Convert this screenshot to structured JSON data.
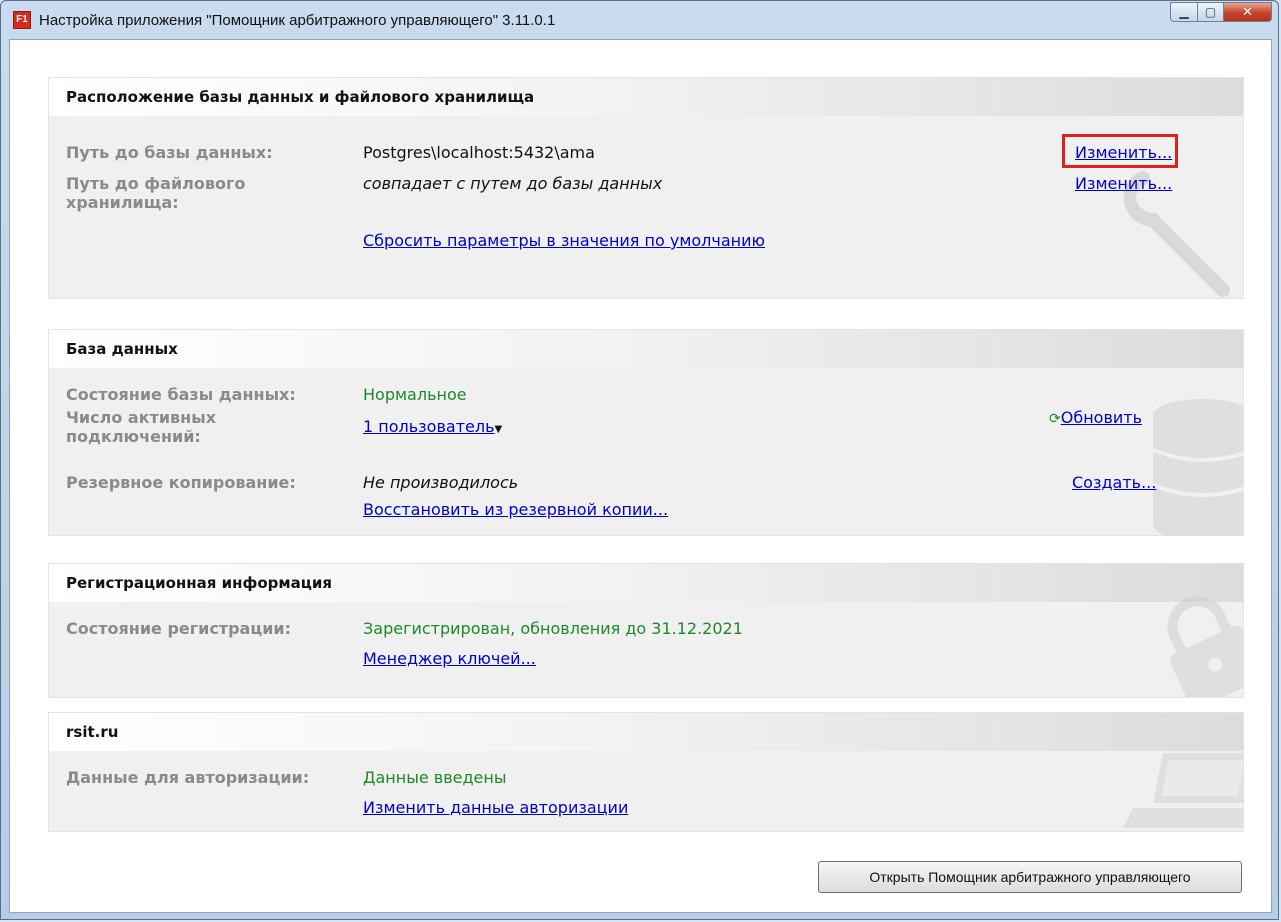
{
  "window": {
    "title": "Настройка приложения \"Помощник арбитражного управляющего\" 3.11.0.1",
    "app_icon_label": "F1",
    "min_glyph": "▁",
    "max_glyph": "▢",
    "close_glyph": "✕"
  },
  "storage": {
    "header": "Расположение базы данных и файлового хранилища",
    "db_path_label": "Путь до базы данных:",
    "db_path_value": "Postgres\\localhost:5432\\ama",
    "db_path_change": "Изменить...",
    "file_path_label": "Путь до файлового хранилища:",
    "file_path_value": "совпадает с путем до базы данных",
    "file_path_change": "Изменить...",
    "reset_link": "Сбросить параметры в значения по умолчанию"
  },
  "database": {
    "header": "База данных",
    "state_label": "Состояние базы данных:",
    "state_value": "Нормальное",
    "connections_label": "Число активных подключений:",
    "connections_value": "1 пользователь",
    "refresh_glyph": "⟳",
    "refresh_link": "Обновить",
    "backup_label": "Резервное копирование:",
    "backup_value": "Не производилось",
    "backup_create": "Создать...",
    "restore_link": "Восстановить из резервной копии..."
  },
  "registration": {
    "header": "Регистрационная информация",
    "state_label": "Состояние регистрации:",
    "state_value": "Зарегистрирован, обновления до 31.12.2021",
    "key_manager_link": "Менеджер ключей..."
  },
  "rsit": {
    "header": "rsit.ru",
    "auth_label": "Данные для авторизации:",
    "auth_value": "Данные введены",
    "auth_change_link": "Изменить данные авторизации"
  },
  "footer": {
    "open_button": "Открыть Помощник арбитражного управляющего"
  }
}
